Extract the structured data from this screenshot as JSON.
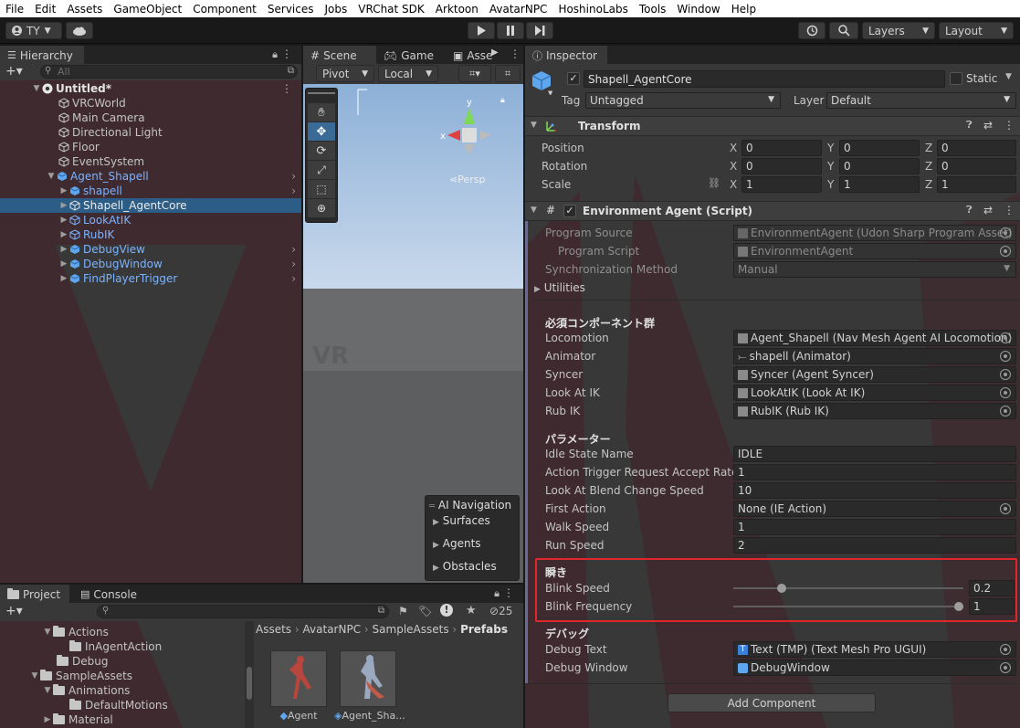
{
  "menu": [
    "File",
    "Edit",
    "Assets",
    "GameObject",
    "Component",
    "Services",
    "Jobs",
    "VRChat SDK",
    "Arktoon",
    "AvatarNPC",
    "HoshinoLabs",
    "Tools",
    "Window",
    "Help"
  ],
  "toolbar": {
    "account": "TY",
    "layers": "Layers",
    "layout": "Layout"
  },
  "hierarchy": {
    "tab": "Hierarchy",
    "search_placeholder": "All",
    "scene": "Untitled*",
    "items": [
      "VRCWorld",
      "Main Camera",
      "Directional Light",
      "Floor",
      "EventSystem",
      "Agent_Shapell",
      "shapell",
      "Shapell_AgentCore",
      "LookAtIK",
      "RubIK",
      "DebugView",
      "DebugWindow",
      "FindPlayerTrigger"
    ]
  },
  "scene_view": {
    "tabs": [
      "Scene",
      "Game",
      "Asse"
    ],
    "pivot": "Pivot",
    "local": "Local",
    "gizmo_y": "y",
    "gizmo_x": "x",
    "persp": "Persp",
    "ai_nav": {
      "title": "AI Navigation",
      "items": [
        "Surfaces",
        "Agents",
        "Obstacles"
      ]
    }
  },
  "inspector": {
    "tab": "Inspector",
    "object_name": "Shapell_AgentCore",
    "static_label": "Static",
    "tag_label": "Tag",
    "tag_value": "Untagged",
    "layer_label": "Layer",
    "layer_value": "Default",
    "transform": {
      "title": "Transform",
      "rows": [
        {
          "label": "Position",
          "x": "0",
          "y": "0",
          "z": "0"
        },
        {
          "label": "Rotation",
          "x": "0",
          "y": "0",
          "z": "0"
        },
        {
          "label": "Scale",
          "x": "1",
          "y": "1",
          "z": "1"
        }
      ]
    },
    "script": {
      "title": "Environment Agent (Script)",
      "program_source_label": "Program Source",
      "program_source_value": "EnvironmentAgent (Udon Sharp Program Asset)",
      "program_script_label": "Program Script",
      "program_script_value": "EnvironmentAgent",
      "sync_label": "Synchronization Method",
      "sync_value": "Manual",
      "utilities": "Utilities",
      "required_header": "必須コンポーネント群",
      "required": [
        {
          "label": "Locomotion",
          "value": "Agent_Shapell (Nav Mesh Agent AI Locomotion)"
        },
        {
          "label": "Animator",
          "value": "shapell (Animator)"
        },
        {
          "label": "Syncer",
          "value": "Syncer (Agent Syncer)"
        },
        {
          "label": "Look At IK",
          "value": "LookAtIK (Look At IK)"
        },
        {
          "label": "Rub IK",
          "value": "RubIK (Rub IK)"
        }
      ],
      "params_header": "パラメーター",
      "params": [
        {
          "label": "Idle State Name",
          "value": "IDLE"
        },
        {
          "label": "Action Trigger Request Accept Rate",
          "value": "1"
        },
        {
          "label": "Look At Blend Change Speed",
          "value": "10"
        },
        {
          "label": "First Action",
          "value": "None (IE Action)"
        },
        {
          "label": "Walk Speed",
          "value": "1"
        },
        {
          "label": "Run Speed",
          "value": "2"
        }
      ],
      "blink_header": "瞬き",
      "blink": [
        {
          "label": "Blink Speed",
          "value": "0.2",
          "level": 0.2
        },
        {
          "label": "Blink Frequency",
          "value": "1",
          "level": 1.0
        }
      ],
      "debug_header": "デバッグ",
      "debug": [
        {
          "label": "Debug Text",
          "value": "Text (TMP) (Text Mesh Pro UGUI)"
        },
        {
          "label": "Debug Window",
          "value": "DebugWindow"
        }
      ]
    },
    "add_component": "Add Component"
  },
  "project": {
    "tabs": [
      "Project",
      "Console"
    ],
    "hidden_count": "25",
    "tree": [
      "Actions",
      "InAgentAction",
      "Debug",
      "SampleAssets",
      "Animations",
      "DefaultMotions",
      "Material"
    ],
    "breadcrumb": [
      "Assets",
      "AvatarNPC",
      "SampleAssets",
      "Prefabs"
    ],
    "assets": [
      "Agent",
      "Agent_Sha..."
    ]
  },
  "colors": {
    "selection": "#2c5d87",
    "highlight_box": "#e0262b",
    "blue_text": "#7bb3ff"
  }
}
